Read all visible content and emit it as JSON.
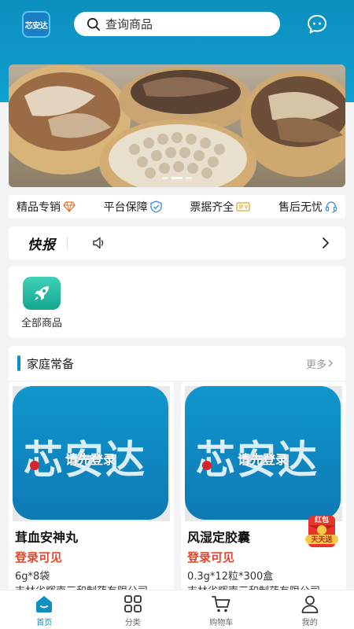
{
  "header": {
    "logo_text": "芯安达",
    "search_placeholder": "查询商品"
  },
  "banner": {
    "dot_count": 3,
    "active_dot": 1
  },
  "guarantees": [
    {
      "label": "精品专销",
      "icon": "diamond-icon"
    },
    {
      "label": "平台保障",
      "icon": "shield-check-icon"
    },
    {
      "label": "票据齐全",
      "icon": "invoice-icon"
    },
    {
      "label": "售后无忧",
      "icon": "headset-icon"
    }
  ],
  "flash": {
    "title": "快报"
  },
  "categories": [
    {
      "label": "全部商品",
      "icon": "rocket-icon"
    }
  ],
  "section": {
    "title": "家庭常备",
    "more_label": "更多"
  },
  "products": [
    {
      "name": "茸血安神丸",
      "price_text": "登录可见",
      "spec": "6g*8袋",
      "maker": "吉林省辉南三和制药有限公司",
      "overlay": "请先登录",
      "brand_text": "芯安达"
    },
    {
      "name": "风湿定胶囊",
      "price_text": "登录可见",
      "spec": "0.3g*12粒*300盒",
      "maker": "吉林省辉南三和制药有限公司",
      "overlay": "请先登录",
      "brand_text": "芯安达"
    }
  ],
  "redpack": {
    "line1": "红包",
    "line2": "天天送"
  },
  "tabbar": [
    {
      "label": "首页",
      "icon": "home-icon",
      "active": true
    },
    {
      "label": "分类",
      "icon": "category-icon",
      "active": false
    },
    {
      "label": "购物车",
      "icon": "cart-icon",
      "active": false
    },
    {
      "label": "我的",
      "icon": "user-icon",
      "active": false
    }
  ],
  "colors": {
    "header_blue": "#0c8fbf",
    "accent": "#0f8fc2",
    "price_red": "#e3472f"
  }
}
